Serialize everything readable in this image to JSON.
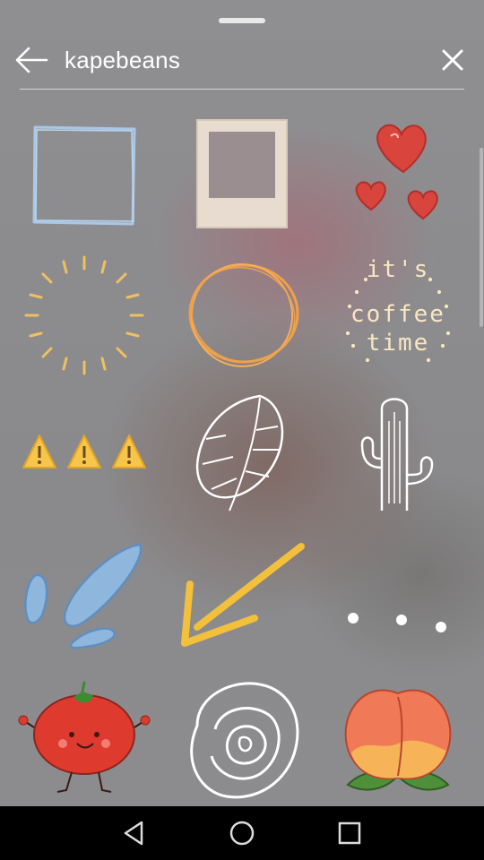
{
  "search": {
    "query": "kapebeans"
  },
  "stickers": {
    "coffee_text_line1": "it's",
    "coffee_text_line2": "coffee",
    "coffee_text_line3": "time"
  },
  "colors": {
    "accent_yellow": "#f2c03a",
    "heart_red": "#d8443c",
    "frame_blue": "#a8c6e4"
  },
  "icons": {
    "back": "arrow-left-icon",
    "clear": "close-icon",
    "nav_back": "triangle-back-icon",
    "nav_home": "circle-home-icon",
    "nav_recents": "square-recents-icon"
  }
}
